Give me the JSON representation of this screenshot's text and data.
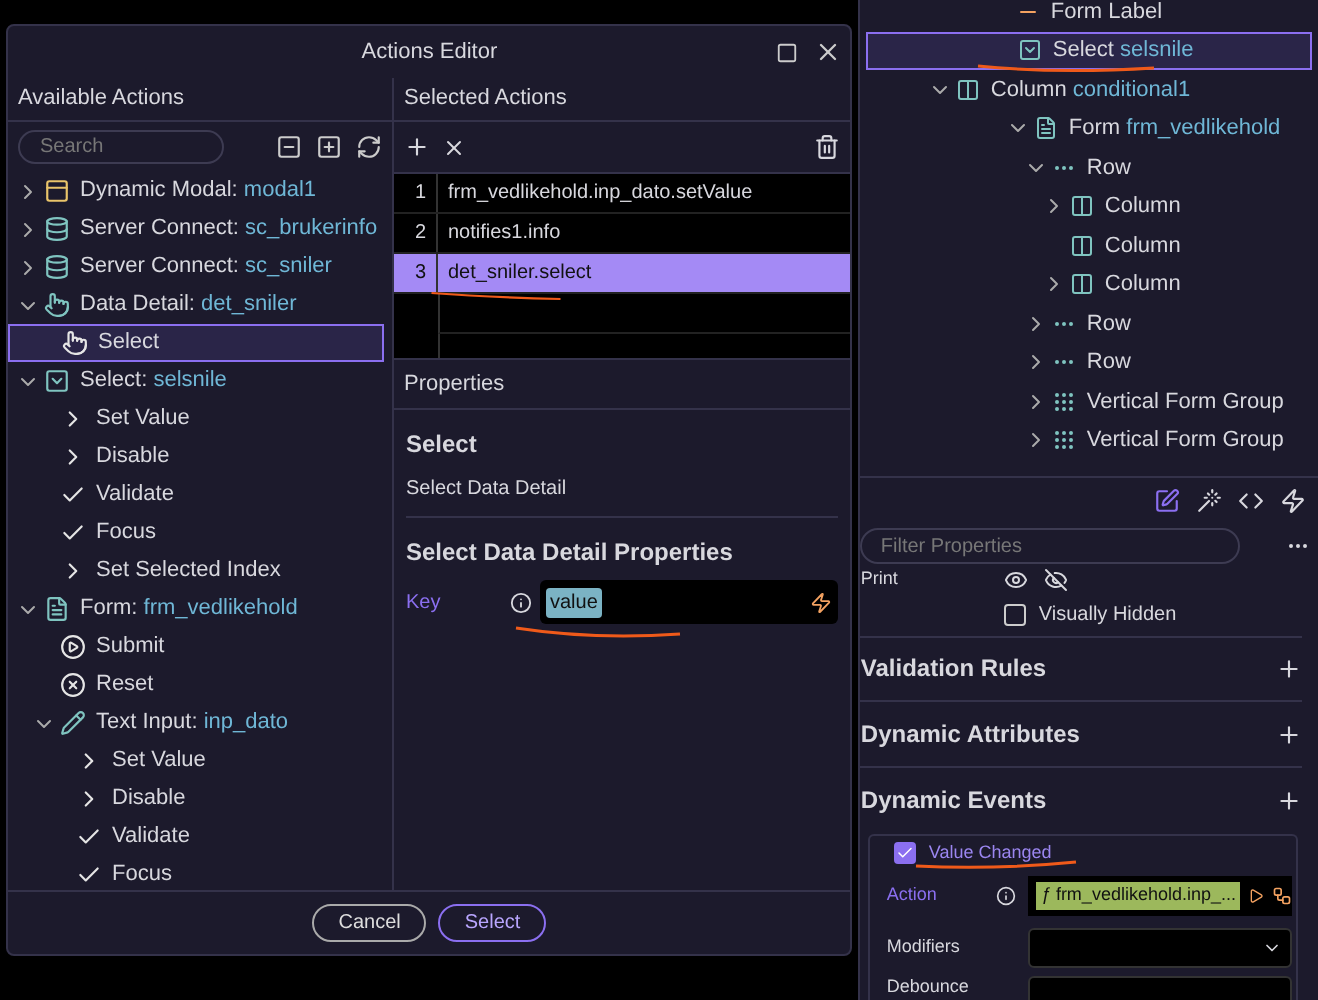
{
  "dialog": {
    "title": "Actions Editor",
    "available": {
      "heading": "Available Actions",
      "search": {
        "placeholder": "Search"
      },
      "tree": [
        {
          "kind": "modal",
          "label": "Dynamic Modal:",
          "name": "modal1",
          "expanded": false,
          "selected": false
        },
        {
          "kind": "server_connect",
          "label": "Server Connect:",
          "name": "sc_brukerinfo",
          "expanded": false,
          "selected": false
        },
        {
          "kind": "server_connect",
          "label": "Server Connect:",
          "name": "sc_sniler",
          "expanded": false,
          "selected": false
        },
        {
          "kind": "data_detail",
          "label": "Data Detail:",
          "name": "det_sniler",
          "expanded": true,
          "selected": false,
          "children": [
            {
              "kind": "hand",
              "label": "Select",
              "selected": true
            }
          ]
        },
        {
          "kind": "select",
          "label": "Select:",
          "name": "selsnile",
          "expanded": true,
          "selected": false,
          "children": [
            {
              "kind": "method_args",
              "label": "Set Value",
              "selected": false
            },
            {
              "kind": "method_args",
              "label": "Disable",
              "selected": false
            },
            {
              "kind": "method",
              "label": "Validate",
              "selected": false
            },
            {
              "kind": "method",
              "label": "Focus",
              "selected": false
            },
            {
              "kind": "method_args",
              "label": "Set Selected Index",
              "selected": false
            }
          ]
        },
        {
          "kind": "form",
          "label": "Form:",
          "name": "frm_vedlikehold",
          "expanded": true,
          "selected": false,
          "children": [
            {
              "kind": "submit",
              "label": "Submit",
              "selected": false
            },
            {
              "kind": "reset",
              "label": "Reset",
              "selected": false
            },
            {
              "kind": "text_input",
              "label": "Text Input:",
              "name": "inp_dato",
              "expanded": true,
              "selected": false,
              "children": [
                {
                  "kind": "method_args",
                  "label": "Set Value",
                  "selected": false
                },
                {
                  "kind": "method_args",
                  "label": "Disable",
                  "selected": false
                },
                {
                  "kind": "method",
                  "label": "Validate",
                  "selected": false
                },
                {
                  "kind": "method",
                  "label": "Focus",
                  "selected": false
                }
              ]
            }
          ]
        }
      ]
    },
    "selected_actions": {
      "heading": "Selected Actions",
      "rows": [
        {
          "number": "1",
          "action": "frm_vedlikehold.inp_dato.setValue",
          "selected": false
        },
        {
          "number": "2",
          "action": "notifies1.info",
          "selected": false
        },
        {
          "number": "3",
          "action": "det_sniler.select",
          "selected": true
        }
      ]
    },
    "properties": {
      "heading": "Properties",
      "title": "Select",
      "subtitle": "Select Data Detail",
      "section": "Select Data Detail Properties",
      "fields": [
        {
          "label": "Key",
          "value": "value"
        }
      ]
    },
    "buttons": [
      {
        "label": "Cancel",
        "kind": "secondary"
      },
      {
        "label": "Select",
        "kind": "primary"
      }
    ]
  },
  "structure": {
    "tree": [
      {
        "kind": "label",
        "label": "Form Label",
        "selected": false
      },
      {
        "kind": "select",
        "label": "Select",
        "name": "selsnile",
        "selected": true
      },
      {
        "kind": "column",
        "label": "Column",
        "name": "conditional1",
        "expanded": true,
        "selected": false,
        "children": [
          {
            "kind": "form",
            "label": "Form",
            "name": "frm_vedlikehold",
            "expanded": true,
            "selected": false,
            "children": [
              {
                "kind": "row",
                "label": "Row",
                "expanded": true,
                "selected": false,
                "children": [
                  {
                    "kind": "column",
                    "label": "Column",
                    "expanded": false,
                    "selected": false
                  },
                  {
                    "kind": "column",
                    "label": "Column",
                    "selected": false
                  },
                  {
                    "kind": "column",
                    "label": "Column",
                    "expanded": false,
                    "selected": false
                  }
                ]
              },
              {
                "kind": "row",
                "label": "Row",
                "expanded": false,
                "selected": false
              },
              {
                "kind": "row",
                "label": "Row",
                "expanded": false,
                "selected": false
              },
              {
                "kind": "group",
                "label": "Vertical Form Group",
                "expanded": false,
                "selected": false
              },
              {
                "kind": "group",
                "label": "Vertical Form Group",
                "expanded": false,
                "selected": false
              }
            ]
          }
        ]
      }
    ]
  },
  "properties_panel": {
    "filter": {
      "placeholder": "Filter Properties"
    },
    "print_label": "Print",
    "visually_hidden": {
      "label": "Visually Hidden",
      "checked": false
    },
    "sections": [
      {
        "title": "Validation Rules"
      },
      {
        "title": "Dynamic Attributes"
      },
      {
        "title": "Dynamic Events"
      }
    ],
    "event": {
      "label": "Value Changed",
      "checked": true,
      "action_label": "Action",
      "action_symbol": "ƒ",
      "action_value": "frm_vedlikehold.inp_...",
      "modifiers_label": "Modifiers",
      "debounce_label": "Debounce"
    }
  }
}
